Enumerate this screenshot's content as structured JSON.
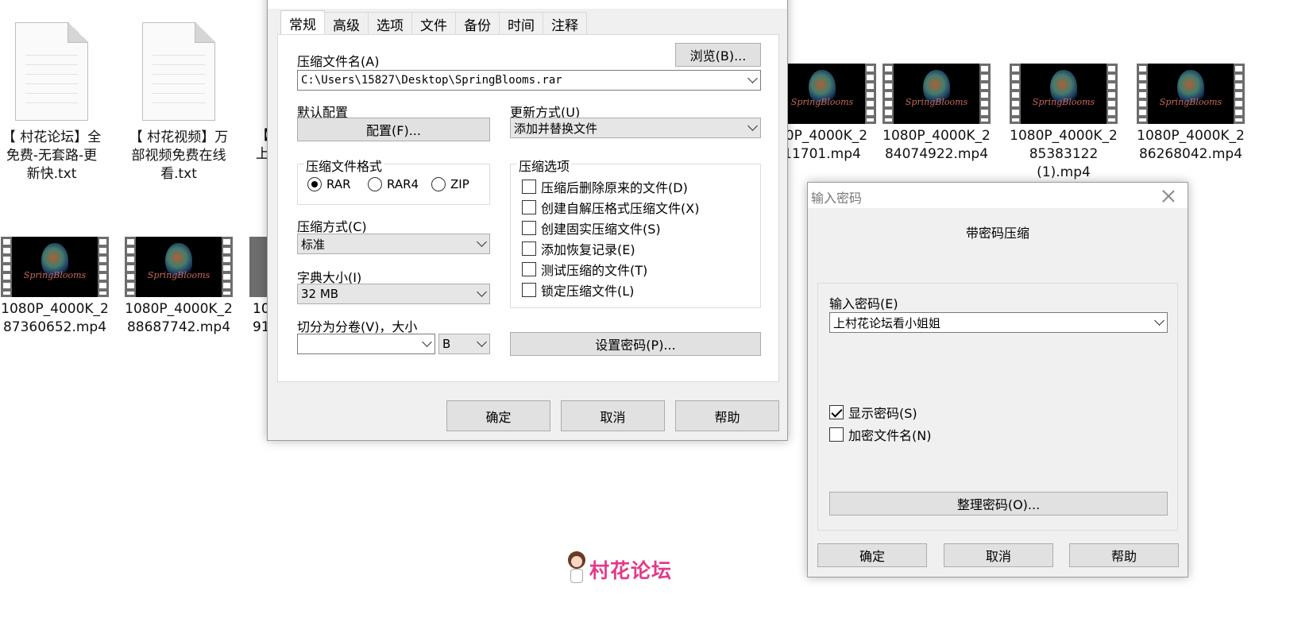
{
  "desktop": {
    "text_files": [
      {
        "label": "【 村花论坛】全免费-无套路-更新快.txt"
      },
      {
        "label": "【 村花视频】万部视频免费在线看.txt"
      }
    ],
    "partial_label_row1": "【\n上",
    "partial_label_row2": "10\n91",
    "video_brand": "SpringBlooms",
    "videos_row1": [
      {
        "label": "80P_4000K_2\n11701.mp4"
      },
      {
        "label": "1080P_4000K_2\n84074922.mp4"
      },
      {
        "label": "1080P_4000K_2\n85383122\n(1).mp4"
      },
      {
        "label": "1080P_4000K_2\n86268042.mp4"
      }
    ],
    "videos_row2": [
      {
        "label": "1080P_4000K_2\n87360652.mp4"
      },
      {
        "label": "1080P_4000K_2\n88687742.mp4"
      }
    ]
  },
  "archive_dialog": {
    "tabs": [
      "常规",
      "高级",
      "选项",
      "文件",
      "备份",
      "时间",
      "注释"
    ],
    "archive_name_label": "压缩文件名(A)",
    "browse_button": "浏览(B)...",
    "archive_path": "C:\\Users\\15827\\Desktop\\SpringBlooms.rar",
    "default_profile_label": "默认配置",
    "profiles_button": "配置(F)...",
    "update_mode_label": "更新方式(U)",
    "update_mode_value": "添加并替换文件",
    "format_group_title": "压缩文件格式",
    "formats": [
      "RAR",
      "RAR4",
      "ZIP"
    ],
    "selected_format": "RAR",
    "options_group_title": "压缩选项",
    "options": [
      {
        "label": "压缩后删除原来的文件(D)",
        "checked": false
      },
      {
        "label": "创建自解压格式压缩文件(X)",
        "checked": false
      },
      {
        "label": "创建固实压缩文件(S)",
        "checked": false
      },
      {
        "label": "添加恢复记录(E)",
        "checked": false
      },
      {
        "label": "测试压缩的文件(T)",
        "checked": false
      },
      {
        "label": "锁定压缩文件(L)",
        "checked": false
      }
    ],
    "method_label": "压缩方式(C)",
    "method_value": "标准",
    "dict_label": "字典大小(I)",
    "dict_value": "32 MB",
    "split_label": "切分为分卷(V)，大小",
    "split_value": "",
    "split_unit": "B",
    "set_password_button": "设置密码(P)...",
    "ok_button": "确定",
    "cancel_button": "取消",
    "help_button": "帮助"
  },
  "password_dialog": {
    "title": "输入密码",
    "heading": "带密码压缩",
    "password_label": "输入密码(E)",
    "password_value": "上村花论坛看小姐姐",
    "show_password_label": "显示密码(S)",
    "show_password_checked": true,
    "encrypt_names_label": "加密文件名(N)",
    "encrypt_names_checked": false,
    "organize_button": "整理密码(O)...",
    "ok_button": "确定",
    "cancel_button": "取消",
    "help_button": "帮助"
  },
  "watermark": {
    "text": "村花论坛"
  }
}
